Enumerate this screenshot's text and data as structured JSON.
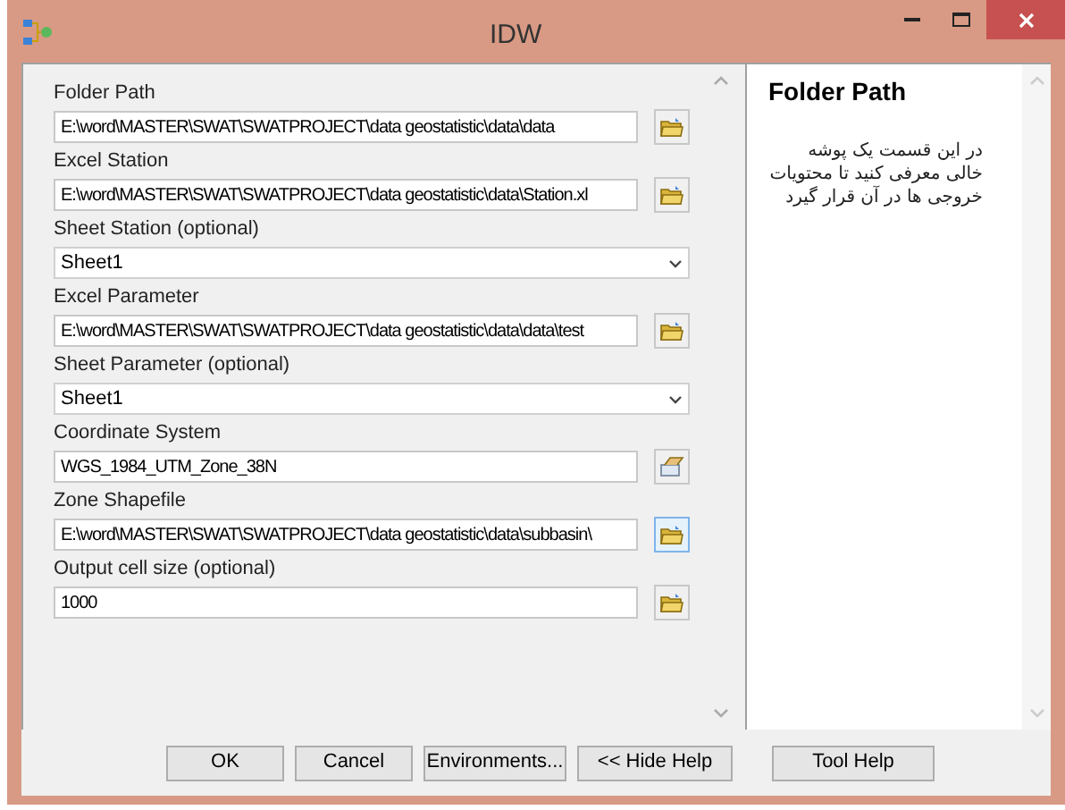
{
  "window": {
    "title": "IDW"
  },
  "fields": [
    {
      "kind": "file",
      "label": "Folder Path",
      "value": "E:\\word\\MASTER\\SWAT\\SWATPROJECT\\data geostatistic\\data\\data",
      "highlighted": false
    },
    {
      "kind": "file",
      "label": "Excel Station",
      "value": "E:\\word\\MASTER\\SWAT\\SWATPROJECT\\data geostatistic\\data\\Station.xl",
      "highlighted": false
    },
    {
      "kind": "dropdown",
      "label": "Sheet Station (optional)",
      "value": "Sheet1"
    },
    {
      "kind": "file",
      "label": "Excel Parameter",
      "value": "E:\\word\\MASTER\\SWAT\\SWATPROJECT\\data geostatistic\\data\\data\\test",
      "highlighted": false
    },
    {
      "kind": "dropdown",
      "label": "Sheet Parameter (optional)",
      "value": "Sheet1"
    },
    {
      "kind": "coordinate",
      "label": "Coordinate System",
      "value": "WGS_1984_UTM_Zone_38N",
      "highlighted": false
    },
    {
      "kind": "file",
      "label": "Zone Shapefile",
      "value": "E:\\word\\MASTER\\SWAT\\SWATPROJECT\\data geostatistic\\data\\subbasin\\",
      "highlighted": true
    },
    {
      "kind": "file",
      "label": "Output cell size (optional)",
      "value": "1000",
      "highlighted": false
    }
  ],
  "help": {
    "title": "Folder Path",
    "text": "در این قسمت یک پوشه خالی معرفی کنید تا محتویات خروجی ها در آن قرار گیرد"
  },
  "buttons": [
    "OK",
    "Cancel",
    "Environments...",
    "<< Hide Help",
    "Tool Help"
  ]
}
